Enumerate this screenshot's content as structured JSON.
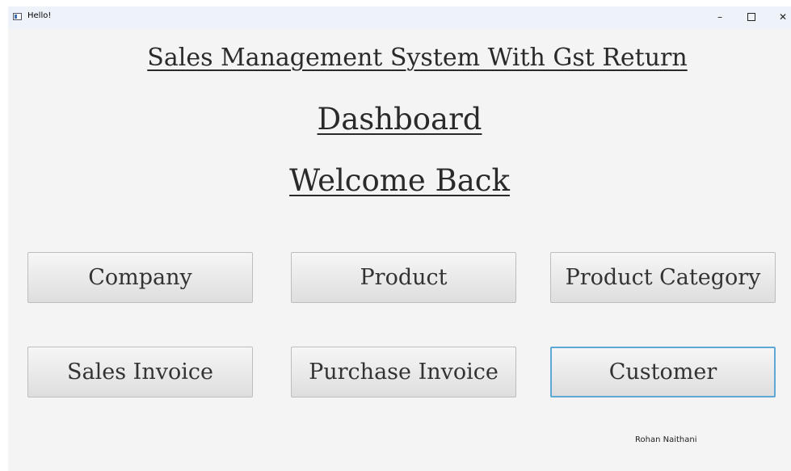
{
  "window": {
    "title": "Hello!",
    "controls": {
      "minimize": "–",
      "close": "✕"
    }
  },
  "headings": {
    "main": "Sales Management System With Gst Return",
    "dashboard": "Dashboard",
    "welcome": "Welcome Back"
  },
  "buttons": {
    "company": "Company",
    "product": "Product",
    "product_category": "Product Category",
    "sales_invoice": "Sales Invoice",
    "purchase_invoice": "Purchase Invoice",
    "customer": "Customer"
  },
  "focused_button": "customer",
  "footer": {
    "author": "Rohan Naithani"
  },
  "colors": {
    "background": "#f4f4f4",
    "titlebar": "#eef3fa",
    "focus_border": "#5ea8d6"
  }
}
